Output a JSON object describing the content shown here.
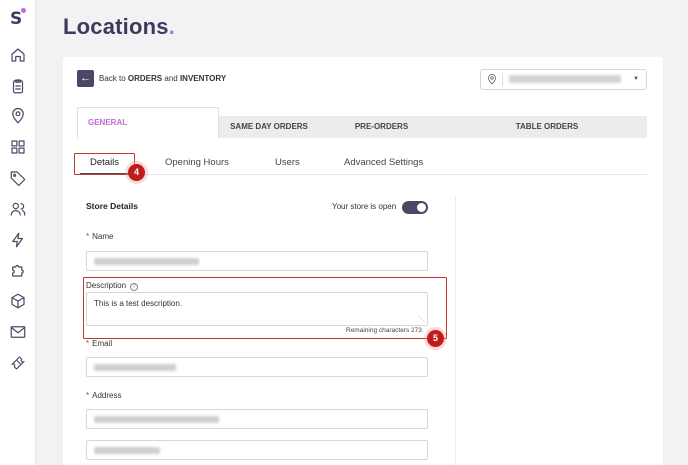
{
  "page": {
    "title": "Locations",
    "title_accent": "."
  },
  "back": {
    "prefix": "Back to ",
    "orders": "ORDERS",
    "and": " and ",
    "inventory": "INVENTORY"
  },
  "top_tabs": [
    "GENERAL",
    "SAME DAY ORDERS",
    "PRE-ORDERS",
    "TABLE ORDERS"
  ],
  "sub_tabs": [
    "Details",
    "Opening Hours",
    "Users",
    "Advanced Settings"
  ],
  "store": {
    "section_title": "Store Details",
    "open_label": "Your store is open",
    "open": true,
    "name_label": "Name",
    "description_label": "Description",
    "description_value": "This is a test description.",
    "remaining": "Remaining characters 273",
    "email_label": "Email",
    "address_label": "Address"
  },
  "annotations": {
    "step4": "4",
    "step5": "5"
  },
  "colors": {
    "brand": "#4a4866",
    "accent": "#c46ad6",
    "annotation": "#c01c1c"
  },
  "icons": [
    "home-icon",
    "clipboard-icon",
    "location-pin-icon",
    "grid-icon",
    "tag-icon",
    "users-icon",
    "lightning-icon",
    "puzzle-icon",
    "box-icon",
    "mail-icon",
    "ticket-icon"
  ]
}
